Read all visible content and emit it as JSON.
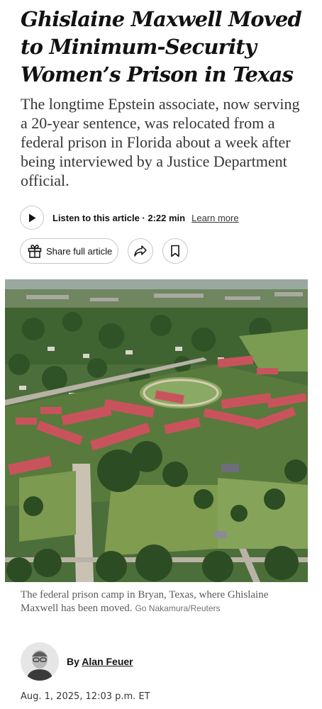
{
  "article": {
    "headline": "Ghislaine Maxwell Moved to Minimum-Security Women’s Prison in Texas",
    "summary": "The longtime Epstein associate, now serving a 20-year sentence, was relocated from a federal prison in Florida about a week after being interviewed by a Justice Department official."
  },
  "audio": {
    "listen_label": "Listen to this article · 2:22 min",
    "learn_more": "Learn more"
  },
  "actions": {
    "share_full_label": "Share full article",
    "icons": [
      "play-icon",
      "gift-icon",
      "share-arrow-icon",
      "bookmark-icon"
    ]
  },
  "photo": {
    "caption": "The federal prison camp in Bryan, Texas, where Ghislaine Maxwell has been moved.",
    "credit": "Go Nakamura/Reuters"
  },
  "byline": {
    "prefix": "By",
    "author": "Alan Feuer"
  },
  "timestamp": "Aug. 1, 2025, 12:03 p.m. ET"
}
